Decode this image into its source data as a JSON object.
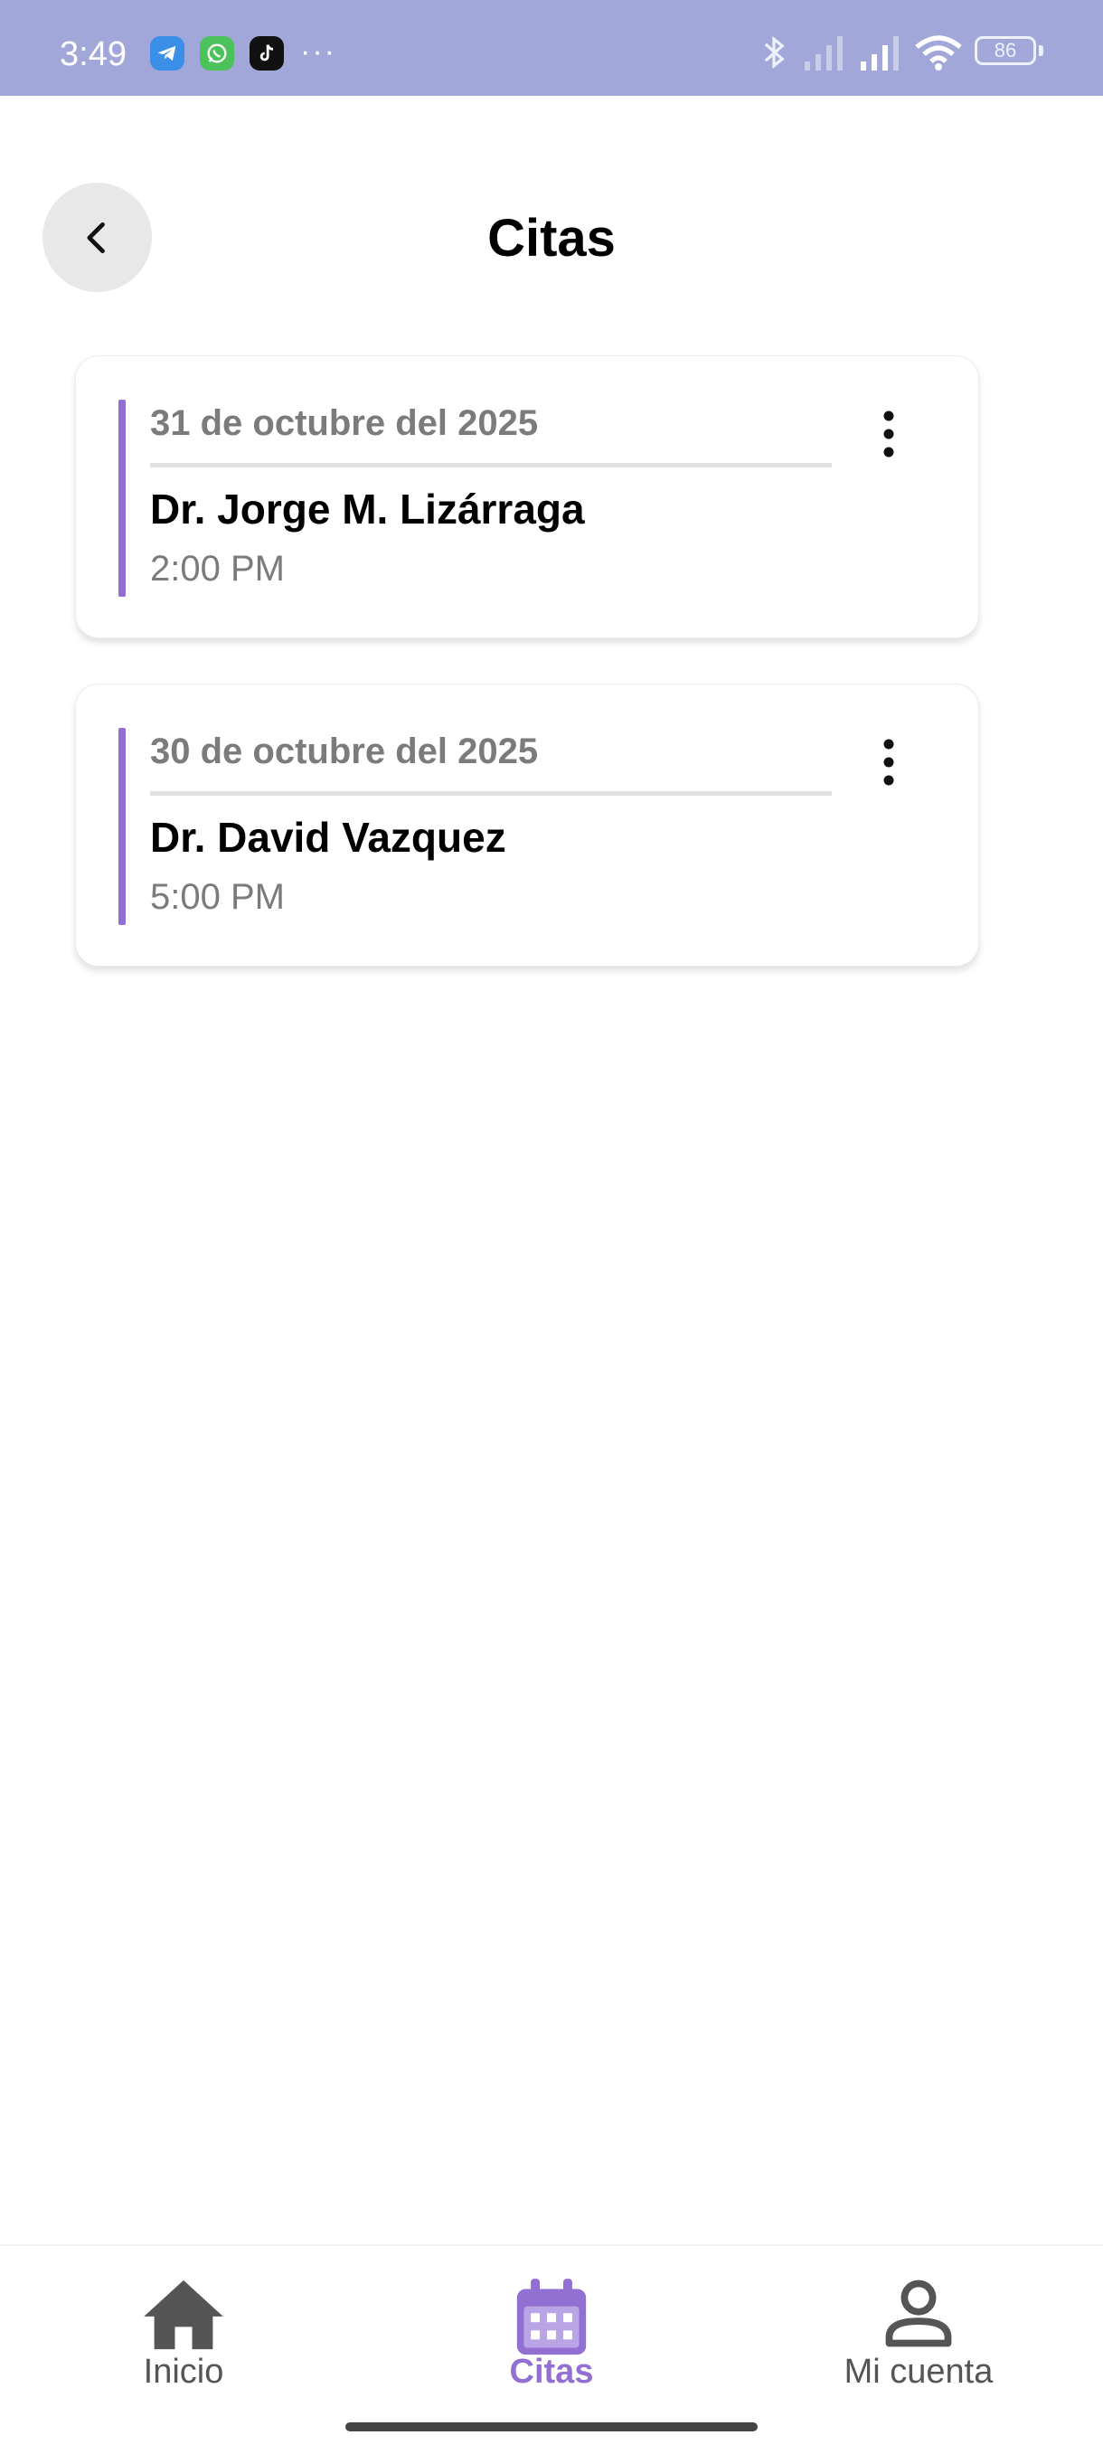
{
  "status_bar": {
    "time": "3:49",
    "battery": "86",
    "icons": [
      "telegram-icon",
      "whatsapp-icon",
      "tiktok-icon",
      "more-dots-icon",
      "bluetooth-icon",
      "signal-icon",
      "signal-icon",
      "wifi-icon",
      "battery-icon"
    ],
    "overflow": "···",
    "background_color": "#a1a8d9"
  },
  "header": {
    "title": "Citas",
    "back_icon": "chevron-left-icon"
  },
  "appointments": [
    {
      "date": "31 de octubre del 2025",
      "doctor": "Dr. Jorge M. Lizárraga",
      "time": "2:00 PM"
    },
    {
      "date": "30 de octubre del 2025",
      "doctor": "Dr. David Vazquez",
      "time": "5:00 PM"
    }
  ],
  "bottom_nav": {
    "items": [
      {
        "label": "Inicio",
        "icon": "home-icon",
        "active": false
      },
      {
        "label": "Citas",
        "icon": "calendar-icon",
        "active": true
      },
      {
        "label": "Mi cuenta",
        "icon": "person-icon",
        "active": false
      }
    ]
  },
  "colors": {
    "accent": "#9270d2",
    "status_bar": "#a1a8d9",
    "muted_text": "#7b7b7b"
  }
}
